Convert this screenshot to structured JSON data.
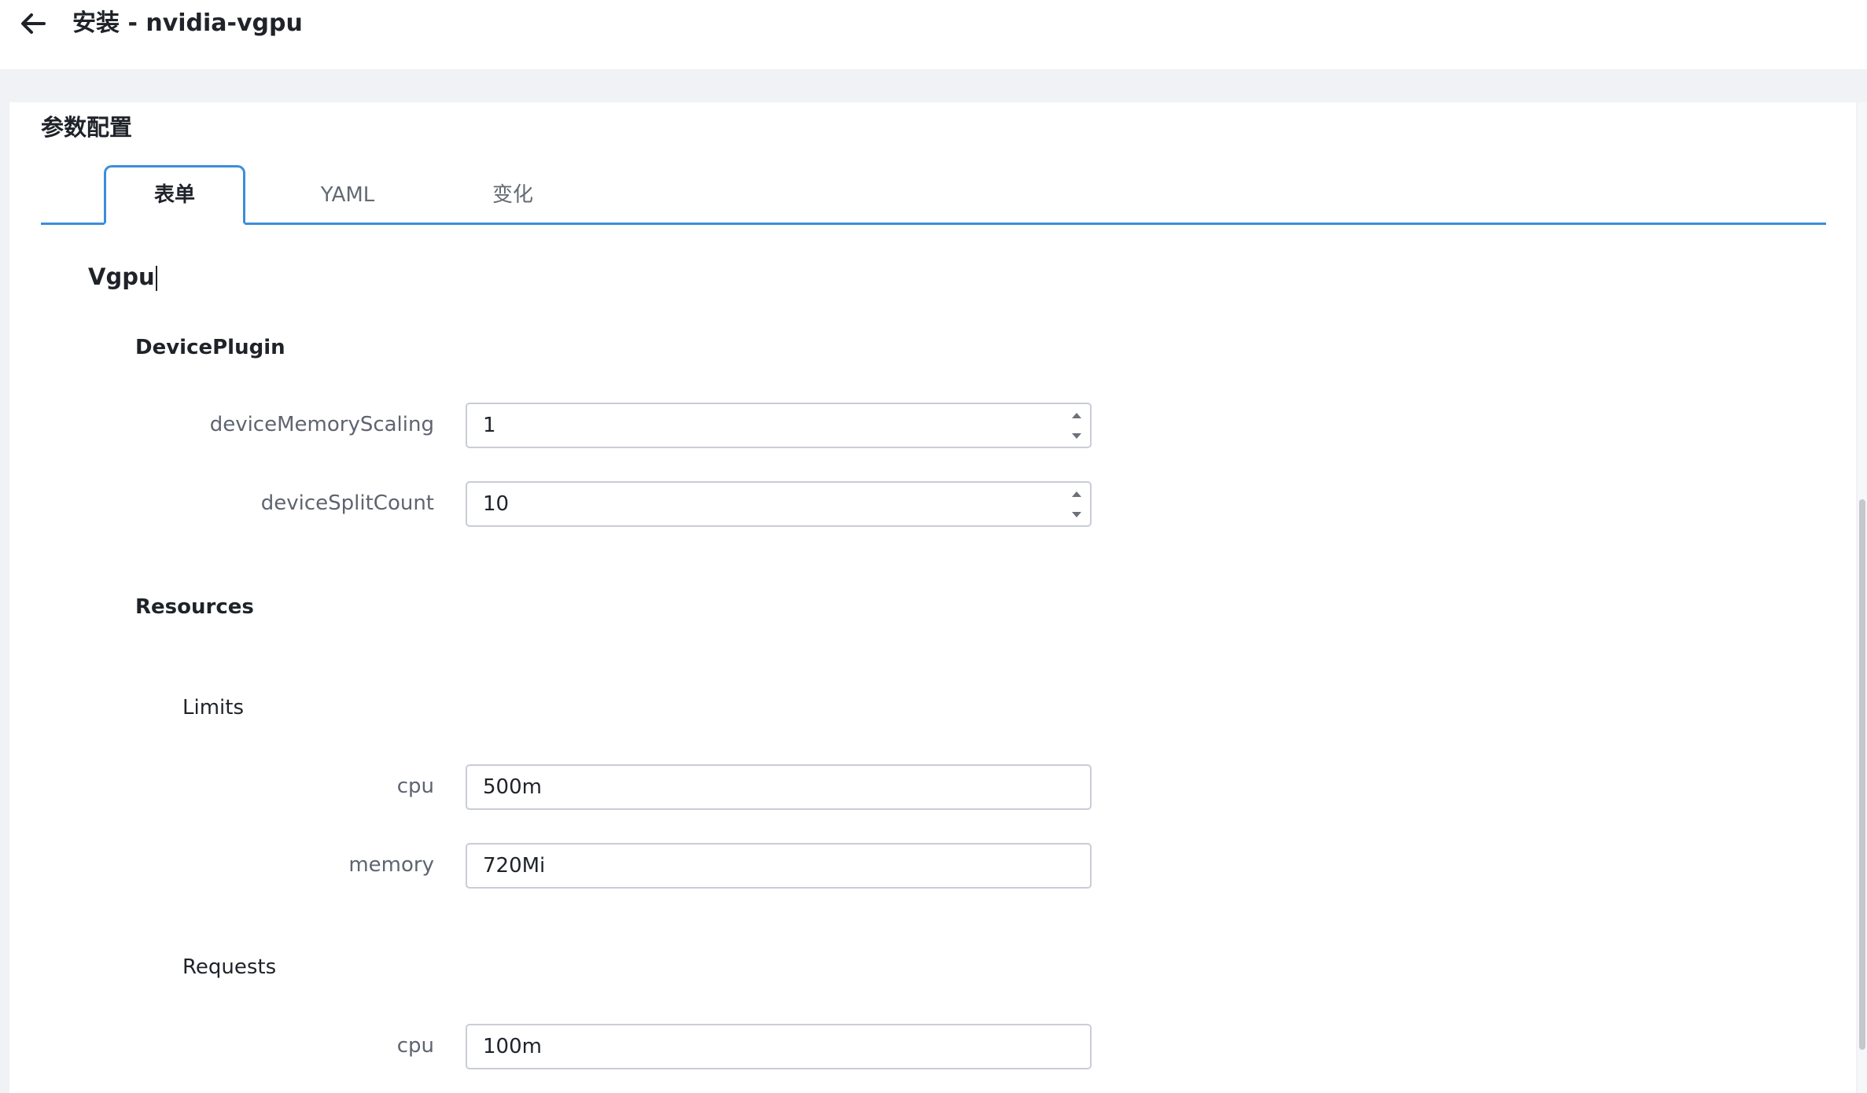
{
  "header": {
    "title": "安装 - nvidia-vgpu",
    "back_icon": "arrow-left-icon"
  },
  "section": {
    "title": "参数配置"
  },
  "tabs": [
    {
      "label": "表单",
      "active": true
    },
    {
      "label": "YAML",
      "active": false
    },
    {
      "label": "变化",
      "active": false
    }
  ],
  "form": {
    "vgpu_title": "Vgpu",
    "device_plugin": {
      "title": "DevicePlugin",
      "device_memory_scaling": {
        "label": "deviceMemoryScaling",
        "value": "1"
      },
      "device_split_count": {
        "label": "deviceSplitCount",
        "value": "10"
      }
    },
    "resources": {
      "title": "Resources",
      "limits": {
        "title": "Limits",
        "cpu": {
          "label": "cpu",
          "value": "500m"
        },
        "memory": {
          "label": "memory",
          "value": "720Mi"
        }
      },
      "requests": {
        "title": "Requests",
        "cpu": {
          "label": "cpu",
          "value": "100m"
        }
      }
    }
  },
  "colors": {
    "accent": "#3b8ed8",
    "background": "#f1f2f5",
    "border": "#c9cdd4"
  }
}
